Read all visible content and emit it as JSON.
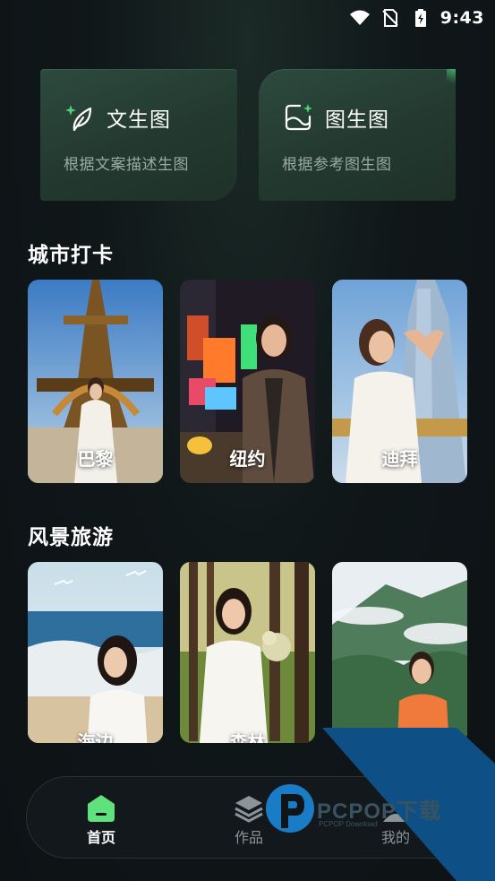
{
  "status_bar": {
    "time": "9:43",
    "icons": [
      "wifi-icon",
      "no-sim-icon",
      "battery-charging-icon"
    ]
  },
  "generators": [
    {
      "title": "文生图",
      "subtitle": "根据文案描述生图",
      "icon": "leaf-sparkle-icon"
    },
    {
      "title": "图生图",
      "subtitle": "根据参考图生图",
      "icon": "image-edit-icon"
    }
  ],
  "sections": {
    "city": {
      "title": "城市打卡",
      "items": [
        {
          "label": "巴黎",
          "scene": "eiffel-tower"
        },
        {
          "label": "纽约",
          "scene": "times-square"
        },
        {
          "label": "迪拜",
          "scene": "burj-khalifa"
        }
      ]
    },
    "scenery": {
      "title": "风景旅游",
      "items": [
        {
          "label": "海边",
          "scene": "beach"
        },
        {
          "label": "森林",
          "scene": "forest"
        },
        {
          "label": "",
          "scene": "mountain"
        }
      ]
    }
  },
  "bottom_nav": {
    "items": [
      {
        "label": "首页",
        "icon": "home-icon",
        "active": true
      },
      {
        "label": "作品",
        "icon": "layers-icon",
        "active": false
      },
      {
        "label": "我的",
        "icon": "profile-icon",
        "active": false
      }
    ]
  },
  "watermark": {
    "text": "PCPOP下载",
    "subtext": "PCPOP Download"
  },
  "colors": {
    "background": "#0e1418",
    "card": "#2d4a3f",
    "accent_green": "#4fd37a",
    "watermark_blue": "#0e4f86"
  }
}
